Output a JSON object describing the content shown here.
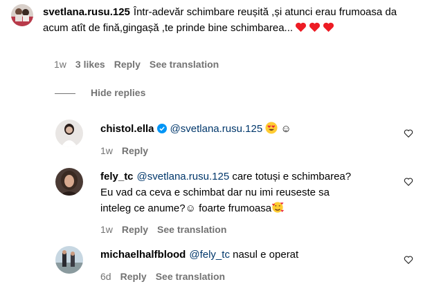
{
  "colors": {
    "mention": "#00376b",
    "meta": "#737373",
    "heart": "#ed1c24"
  },
  "comments": [
    {
      "username": "svetlana.rusu.125",
      "text": "Într-adevăr schimbare reușită ,și atunci erau frumoasa da acum atît de fină,gingașă ,te prinde bine schimbarea...",
      "time": "1w",
      "likes": "3 likes",
      "reply": "Reply",
      "see_translation": "See translation",
      "trailing_icons": [
        "heart-emoji",
        "heart-emoji",
        "heart-emoji"
      ]
    }
  ],
  "hide_replies": "Hide replies",
  "replies": [
    {
      "username": "chistol.ella",
      "verified": true,
      "mention": "@svetlana.rusu.125",
      "text": "☺",
      "emoji": "heart-eyes-emoji",
      "time": "1w",
      "reply": "Reply"
    },
    {
      "username": "fely_tc",
      "mention": "@svetlana.rusu.125",
      "text_line1": "care totuși e schimbarea?",
      "text_line2": "Eu vad ca ceva e schimbat dar nu imi reuseste sa",
      "text_line3": "inteleg ce anume?☺ foarte frumoasa",
      "emoji": "smiling-face-with-hearts-emoji",
      "time": "1w",
      "reply": "Reply",
      "see_translation": "See translation"
    },
    {
      "username": "michaelhalfblood",
      "mention": "@fely_tc",
      "text": "nasul e operat",
      "time": "6d",
      "reply": "Reply",
      "see_translation": "See translation"
    }
  ]
}
